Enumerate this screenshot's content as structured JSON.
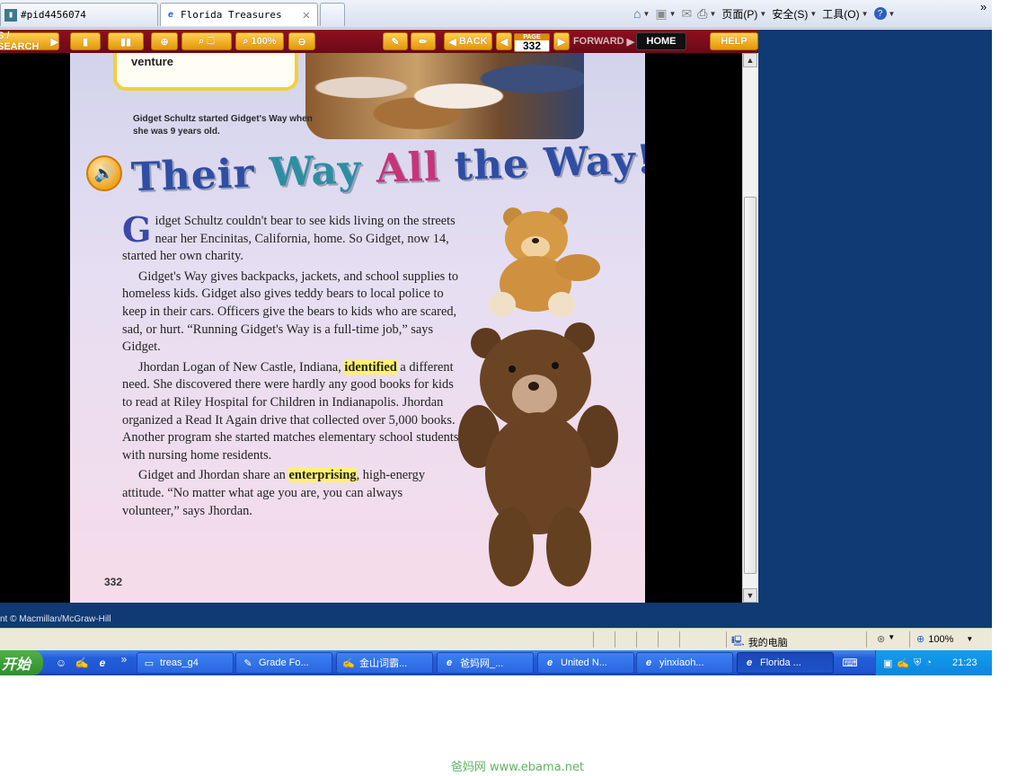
{
  "browser": {
    "tabs": [
      {
        "label": "#pid4456074",
        "icon": "page-icon"
      },
      {
        "label": "Florida Treasures",
        "icon": "ie-icon",
        "active": true
      }
    ],
    "new_tab_label": "",
    "commands": {
      "home": "",
      "feeds": "",
      "mail": "",
      "print": "",
      "page": "页面(P)",
      "safety": "安全(S)",
      "tools": "工具(O)",
      "help": ""
    }
  },
  "reader_toolbar": {
    "search": "S / SEARCH",
    "zoom_percent": "100%",
    "back": "BACK",
    "page_label": "PAGE",
    "page_number": "332",
    "forward": "FORWARD",
    "home": "HOME",
    "help": "HELP"
  },
  "page": {
    "box_text": "venture",
    "caption": "Gidget Schultz started Gidget's Way when she was 9 years old.",
    "headline": {
      "w1": "Their",
      "w2": "Way",
      "w3": "All",
      "w4": "the Way!"
    },
    "p1": {
      "dropcap": "G",
      "text": "idget Schultz couldn't bear to see kids living on the streets near her Encinitas, California, home. So Gidget, now 14, started her own charity."
    },
    "p2": "Gidget's Way gives backpacks, jackets, and school supplies to homeless kids. Gidget also gives teddy bears to local police to keep in their cars. Officers give the bears to kids who are scared, sad, or hurt. “Running Gidget's Way is a full-time job,” says Gidget.",
    "p3": {
      "before": "Jhordan Logan of New Castle, Indiana, ",
      "highlight": "identified",
      "after": " a different need. She discovered there were hardly any good books for kids to read at Riley Hospital for Children in Indianapolis. Jhordan organized a Read It Again drive that collected over 5,000 books. Another program she started matches elementary school students with nursing home residents."
    },
    "p4": {
      "before": "Gidget and Jhordan share an ",
      "highlight": "enterprising",
      "after": ", high-energy attitude. “No matter what age you are, you can always volunteer,” says Jhordan."
    },
    "page_number": "332"
  },
  "copyright": "nt © Macmillan/McGraw-Hill",
  "status_bar": {
    "zone": "我的电脑",
    "zoom": "100%"
  },
  "taskbar": {
    "start": "开始",
    "buttons": [
      {
        "label": "treas_g4",
        "icon": "folder-icon"
      },
      {
        "label": "Grade Fo...",
        "icon": "paint-icon"
      },
      {
        "label": "金山词霸...",
        "icon": "dictionary-icon"
      },
      {
        "label": "爸妈网_...",
        "icon": "ie-icon"
      },
      {
        "label": "United N...",
        "icon": "ie-icon"
      },
      {
        "label": "yinxiaoh...",
        "icon": "ie-icon"
      },
      {
        "label": "Florida ...",
        "icon": "ie-icon",
        "active": true
      }
    ],
    "clock": "21:23"
  },
  "watermark": "爸妈网 www.ebama.net",
  "colors": {
    "toolbar_red": "#7a0c1a",
    "button_gold": "#f0b02a",
    "desktop_blue": "#0f3a73",
    "headline_blue": "#2f4ea3",
    "headline_teal": "#2d8ea2",
    "headline_pink": "#c8347a",
    "highlight_yellow": "#fff36b"
  }
}
